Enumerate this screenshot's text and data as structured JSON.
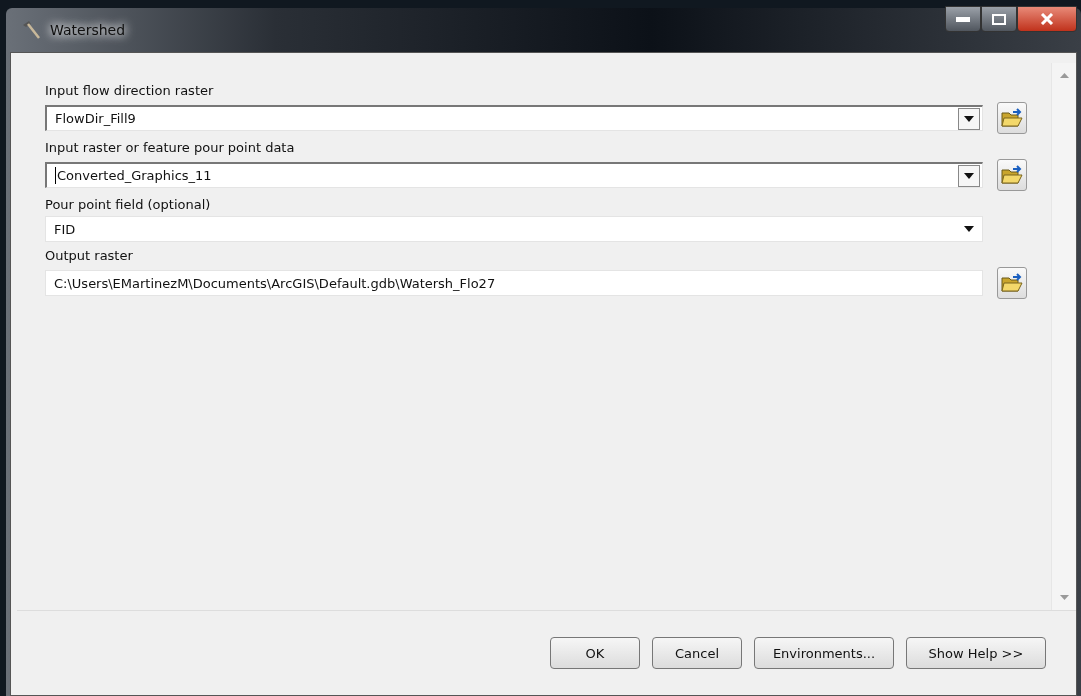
{
  "window": {
    "title": "Watershed"
  },
  "parameters": [
    {
      "label": "Input flow direction raster",
      "kind": "combo",
      "value": "FlowDir_Fill9",
      "browse": true,
      "focused": false
    },
    {
      "label": "Input raster or feature pour point data",
      "kind": "combo",
      "value": "Converted_Graphics_11",
      "browse": true,
      "focused": true
    },
    {
      "label": "Pour point field (optional)",
      "kind": "select",
      "value": "FID",
      "browse": false,
      "focused": false
    },
    {
      "label": "Output raster",
      "kind": "text",
      "value": "C:\\Users\\EMartinezM\\Documents\\ArcGIS\\Default.gdb\\Watersh_Flo27",
      "browse": true,
      "focused": false
    }
  ],
  "buttons": [
    "OK",
    "Cancel",
    "Environments...",
    "Show Help >>"
  ]
}
